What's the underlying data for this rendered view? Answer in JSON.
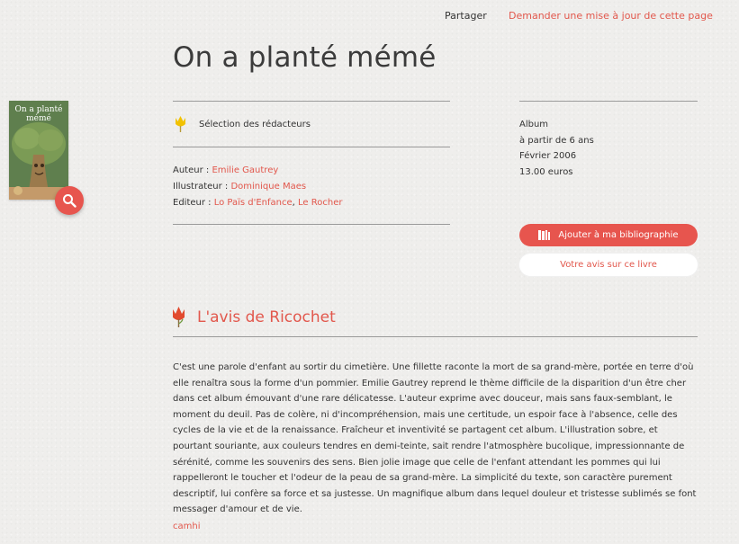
{
  "header": {
    "share_label": "Partager",
    "request_update_label": "Demander une mise à jour de cette page"
  },
  "book": {
    "title": "On a planté mémé",
    "cover_title": "On a planté mémé",
    "badge": {
      "icon": "yellow-tulip-icon",
      "label": "Sélection des rédacteurs"
    },
    "credits": {
      "author_label": "Auteur : ",
      "author": "Emilie Gautrey",
      "illustrator_label": "Illustrateur : ",
      "illustrator": "Dominique Maes",
      "editor_label": "Editeur : ",
      "editor_1": "Lo Païs d'Enfance",
      "editor_sep": ", ",
      "editor_2": "Le Rocher"
    },
    "meta": {
      "type": "Album",
      "age": "à partir de 6 ans",
      "date": "Février 2006",
      "price": "13.00 euros"
    }
  },
  "actions": {
    "add_to_bibliography": "Ajouter à ma bibliographie",
    "review_book": "Votre avis sur ce livre"
  },
  "review": {
    "icon": "red-tulip-icon",
    "heading": "L'avis de Ricochet",
    "body": "C'est une parole d'enfant au sortir du cimetière. Une fillette raconte la mort de sa grand-mère, portée en terre d'où elle renaîtra sous la forme d'un pommier. Emilie Gautrey reprend le thème difficile de la disparition d'un être cher dans cet album émouvant d'une rare délicatesse. L'auteur exprime avec douceur, mais sans faux-semblant, le moment du deuil. Pas de colère, ni d'incompréhension, mais une certitude, un espoir face à l'absence, celle des cycles de la vie et de la renaissance. Fraîcheur et inventivité se partagent cet album. L'illustration sobre, et pourtant souriante, aux couleurs tendres en demi-teinte, sait rendre l'atmosphère bucolique, impressionnante de sérénité, comme les souvenirs des sens. Bien jolie image que celle de l'enfant attendant les pommes qui lui rappelleront le toucher et l'odeur de la peau de sa grand-mère. La simplicité du texte, son caractère purement descriptif, lui confère sa force et sa justesse. Un magnifique album dans lequel douleur et tristesse sublimés se font messager d'amour et de vie.",
    "author": "camhi"
  },
  "colors": {
    "accent": "#e2574c",
    "background": "#efeeec",
    "text": "#333333",
    "rule": "#9a9a9a"
  }
}
